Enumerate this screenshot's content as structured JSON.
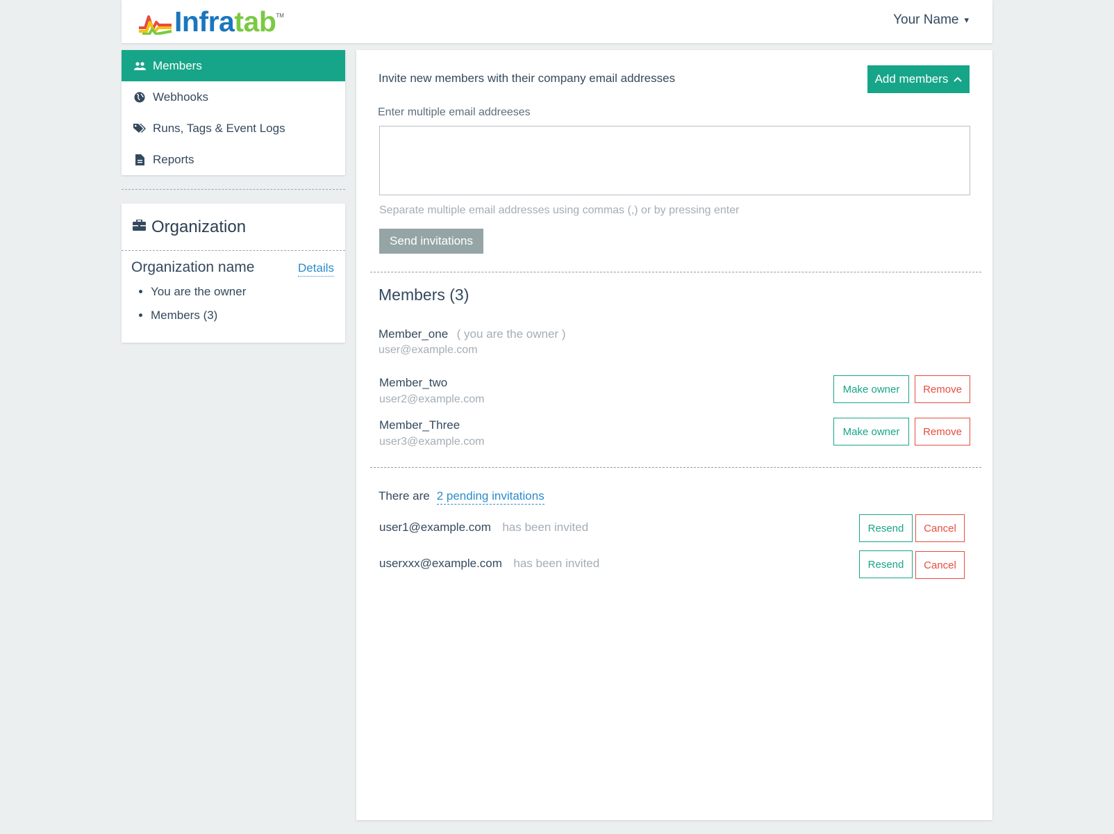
{
  "header": {
    "logo_text_a": "Infra",
    "logo_text_b": "tab",
    "logo_tm": "TM",
    "user_name": "Your Name",
    "user_caret": "▾"
  },
  "sidebar": {
    "items": [
      {
        "label": "Members",
        "icon": "users-icon",
        "active": true
      },
      {
        "label": "Webhooks",
        "icon": "globe-icon",
        "active": false
      },
      {
        "label": "Runs, Tags & Event Logs",
        "icon": "tags-icon",
        "active": false
      },
      {
        "label": "Reports",
        "icon": "file-icon",
        "active": false
      }
    ]
  },
  "organization": {
    "title": "Organization",
    "name": "Organization name",
    "details_label": "Details",
    "facts": [
      "You are the owner",
      "Members (3)"
    ]
  },
  "invite": {
    "label": "Invite new members with their company email addresses",
    "add_button": "Add members",
    "email_label": "Enter multiple email addreeses",
    "email_value": "",
    "hint": "Separate multiple email addresses using commas (,) or by pressing enter",
    "send_button": "Send invitations"
  },
  "members": {
    "title": "Members (3)",
    "owner_note": "( you are the owner )",
    "make_owner_label": "Make owner",
    "remove_label": "Remove",
    "list": [
      {
        "name": "Member_one",
        "email": "user@example.com",
        "is_owner": true
      },
      {
        "name": "Member_two",
        "email": "user2@example.com",
        "is_owner": false
      },
      {
        "name": "Member_Three",
        "email": "user3@example.com",
        "is_owner": false
      }
    ]
  },
  "pending": {
    "prefix": "There are",
    "link": "2 pending invitations",
    "status": "has been invited",
    "resend_label": "Resend",
    "cancel_label": "Cancel",
    "list": [
      {
        "email": "user1@example.com"
      },
      {
        "email": "userxxx@example.com"
      }
    ]
  },
  "colors": {
    "accent": "#17a589",
    "danger": "#e74c3c",
    "link": "#2a8bc9",
    "background": "#ebeff0"
  }
}
